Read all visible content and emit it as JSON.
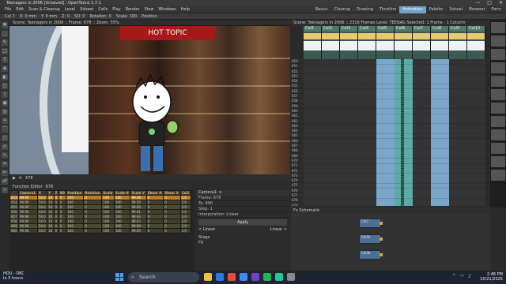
{
  "window": {
    "title": "Teenagers in 2006 [Unsaved] : OpenToonz 1.7.1",
    "controls": [
      "—",
      "□",
      "✕"
    ]
  },
  "menu": [
    "File",
    "Edit",
    "Scan & Cleanup",
    "Level",
    "Xsheet",
    "Cells",
    "Play",
    "Render",
    "View",
    "Windows",
    "Help"
  ],
  "rooms": [
    "Basics",
    "Cleanup",
    "Drawing",
    "Timeline",
    "Animation",
    "Palette",
    "Xsheet",
    "Browser",
    "Farm"
  ],
  "active_room": "Animation",
  "tool_options": [
    "Col 7",
    "X: 0 mm",
    "Y: 0 mm",
    "Z: 0",
    "SO: 0",
    "Rotation: 0",
    "Scale: 100",
    "Position"
  ],
  "viewer": {
    "header": "Scene: Teenagers in 2006  ::  Frame: 678  ::  Zoom: 55%",
    "banner_text": "HOT TOPIC",
    "footer": "678"
  },
  "xsheet": {
    "header": "Scene: Teenagers in 2006  ::  2316 Frames  Level: TEENAG  Selected: 1 Frame : 1 Column",
    "columns": [
      "Col1",
      "Col2",
      "Col3",
      "Col4",
      "Col5",
      "Col6",
      "Col7",
      "Col8",
      "Col9",
      "Col10"
    ],
    "frame_start": 650,
    "frame_numbers": [
      "650",
      "651",
      "652",
      "653",
      "654",
      "655",
      "656",
      "657",
      "658",
      "659",
      "660",
      "661",
      "662",
      "663",
      "664",
      "665",
      "666",
      "667",
      "668",
      "669",
      "670",
      "671",
      "672",
      "673",
      "674",
      "675",
      "676",
      "677",
      "678",
      "679"
    ]
  },
  "function_editor": {
    "title": "Function Editor",
    "frame_label": "678",
    "headers": [
      "",
      "Camera1",
      "X",
      "Y",
      "Z",
      "SO",
      "Position",
      "Rotation",
      "Scale",
      "Scale H",
      "Scale V",
      "Shear H",
      "Shear V",
      "Col1"
    ],
    "rows": [
      [
        "653",
        "99.90",
        "54.0",
        "10",
        "0",
        "0",
        "100",
        "0",
        "100",
        "100",
        "99.58",
        "0",
        "0",
        "2.0"
      ],
      [
        "654",
        "99.90",
        "54.0",
        "10",
        "0",
        "0",
        "100",
        "0",
        "100",
        "100",
        "99.59",
        "0",
        "0",
        "2.0"
      ],
      [
        "655",
        "99.90",
        "54.0",
        "10",
        "0",
        "0",
        "100",
        "0",
        "100",
        "100",
        "99.60",
        "0",
        "0",
        "2.0"
      ],
      [
        "656",
        "99.90",
        "54.0",
        "10",
        "0",
        "0",
        "100",
        "0",
        "100",
        "100",
        "99.61",
        "0",
        "0",
        "2.0"
      ],
      [
        "657",
        "99.90",
        "54.0",
        "10",
        "0",
        "0",
        "100",
        "0",
        "100",
        "100",
        "99.62",
        "0",
        "0",
        "2.0"
      ],
      [
        "658",
        "99.90",
        "54.0",
        "10",
        "0",
        "0",
        "100",
        "0",
        "100",
        "100",
        "99.63",
        "0",
        "0",
        "2.0"
      ],
      [
        "659",
        "99.90",
        "54.0",
        "10",
        "0",
        "0",
        "100",
        "0",
        "100",
        "100",
        "99.64",
        "0",
        "0",
        "2.0"
      ],
      [
        "660",
        "99.90",
        "54.0",
        "10",
        "0",
        "0",
        "100",
        "0",
        "100",
        "100",
        "99.65",
        "0",
        "0",
        "2.0"
      ]
    ]
  },
  "interpolation": {
    "title": "Camera1: x",
    "fields": [
      "Frame: 678",
      "To: 990",
      "Step: 1",
      "Interpolation: Linear"
    ],
    "apply": "Apply",
    "prev": "< Linear",
    "next": "Linear >",
    "tree": [
      "Stage",
      "FX"
    ]
  },
  "schematic": {
    "header": "Fx Schematic",
    "nodes": [
      "Col2",
      "Col1b",
      "Col3b"
    ]
  },
  "taskbar": {
    "weather_temp": "HOU - OKC",
    "weather_sub": "In 5 hours",
    "search_placeholder": "Search",
    "time": "2:46 PM",
    "date": "10/21/2025"
  }
}
